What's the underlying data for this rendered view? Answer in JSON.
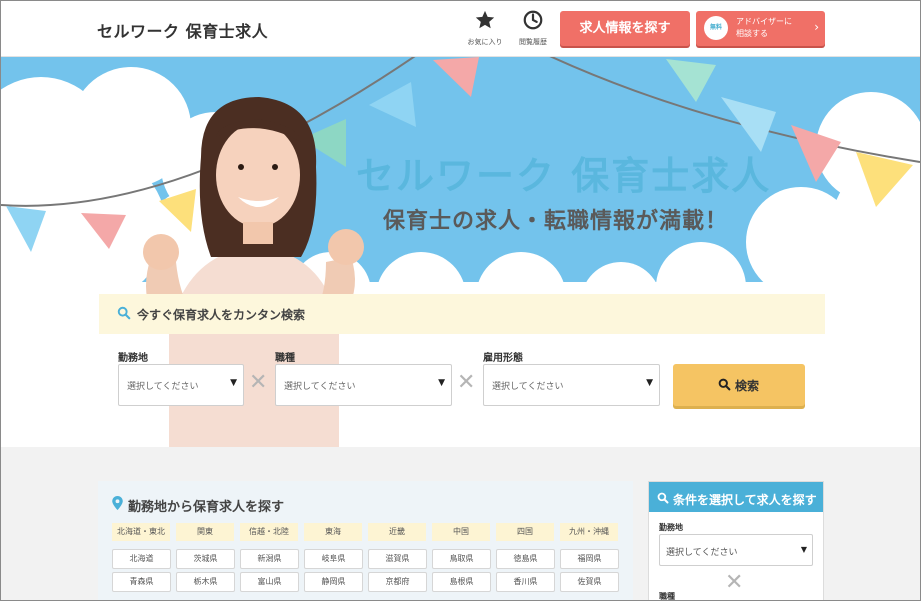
{
  "header": {
    "logo": "セルワーク 保育士求人",
    "favorites_label": "お気に入り",
    "history_label": "閲覧履歴",
    "search_jobs_button": "求人情報を探す",
    "advisor_badge": "無料",
    "advisor_line1": "アドバイザーに",
    "advisor_line2": "相談する"
  },
  "hero": {
    "title": "セルワーク 保育士求人",
    "subtitle": "保育士の求人・転職情報が満載！"
  },
  "search": {
    "title": "今すぐ保育求人をカンタン検索",
    "fields": [
      {
        "label": "勤務地",
        "placeholder": "選択してください"
      },
      {
        "label": "職種",
        "placeholder": "選択してください"
      },
      {
        "label": "雇用形態",
        "placeholder": "選択してください"
      }
    ],
    "submit": "検索"
  },
  "area": {
    "title": "勤務地から保育求人を探す",
    "regions": [
      "北海道・東北",
      "関東",
      "信越・北陸",
      "東海",
      "近畿",
      "中国",
      "四国",
      "九州・沖縄"
    ],
    "rows": [
      [
        "北海道",
        "茨城県",
        "新潟県",
        "岐阜県",
        "滋賀県",
        "鳥取県",
        "徳島県",
        "福岡県"
      ],
      [
        "青森県",
        "栃木県",
        "富山県",
        "静岡県",
        "京都府",
        "島根県",
        "香川県",
        "佐賀県"
      ]
    ]
  },
  "conditions": {
    "title": "条件を選択して求人を探す",
    "location_label": "勤務地",
    "location_placeholder": "選択してください",
    "job_label": "職種"
  },
  "colors": {
    "accent_red": "#f07067",
    "hero_blue": "#73c3ec",
    "search_yellow": "#f5c463",
    "panel_blue": "#4ab0d8"
  }
}
